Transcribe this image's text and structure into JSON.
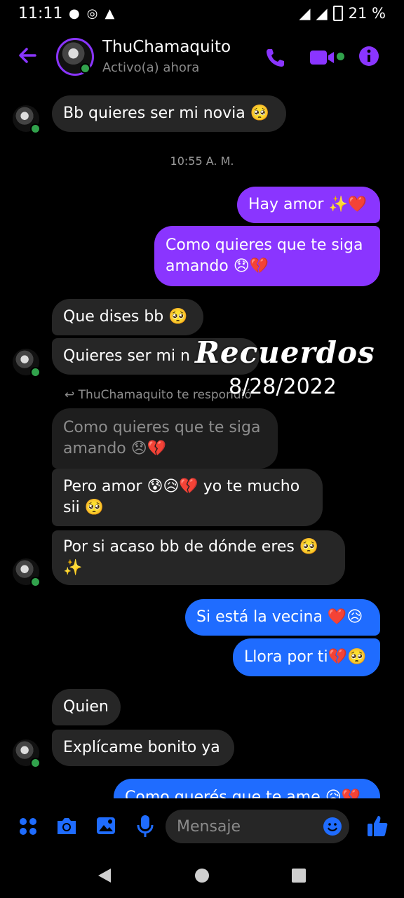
{
  "status_bar": {
    "time": "11:11",
    "battery": "21 %"
  },
  "header": {
    "contact_name": "ThuChamaquito",
    "presence": "Activo(a) ahora"
  },
  "messages": [
    {
      "text": "Bb quieres ser mi novia 🥺"
    },
    {
      "timestamp": "10:55 A. M."
    },
    {
      "text": "Hay amor ✨❤️"
    },
    {
      "text": "Como quieres que te siga amando 😞💔"
    },
    {
      "text": "Que dises bb 🥺"
    },
    {
      "text": "Quieres ser mi n"
    },
    {
      "reply_label": "ThuChamaquito te respondió"
    },
    {
      "text": "Como quieres que te siga amando 😞💔"
    },
    {
      "text": "Pero amor 😰😥💔 yo te mucho sii 🥺"
    },
    {
      "text": "Por si acaso bb de dónde eres 🥺✨"
    },
    {
      "text": "Si está la vecina ❤️😥"
    },
    {
      "text": "Llora por ti💔🥺"
    },
    {
      "text": "Quien"
    },
    {
      "text": "Explícame bonito ya"
    },
    {
      "text": "Como querés que te ame 😥💔"
    }
  ],
  "overlay": {
    "title": "Recuerdos",
    "date": "8/28/2022"
  },
  "composer": {
    "placeholder": "Mensaje"
  },
  "colors": {
    "accent_purple": "#8a35ff",
    "accent_blue": "#1f6cff",
    "incoming": "#262626"
  }
}
